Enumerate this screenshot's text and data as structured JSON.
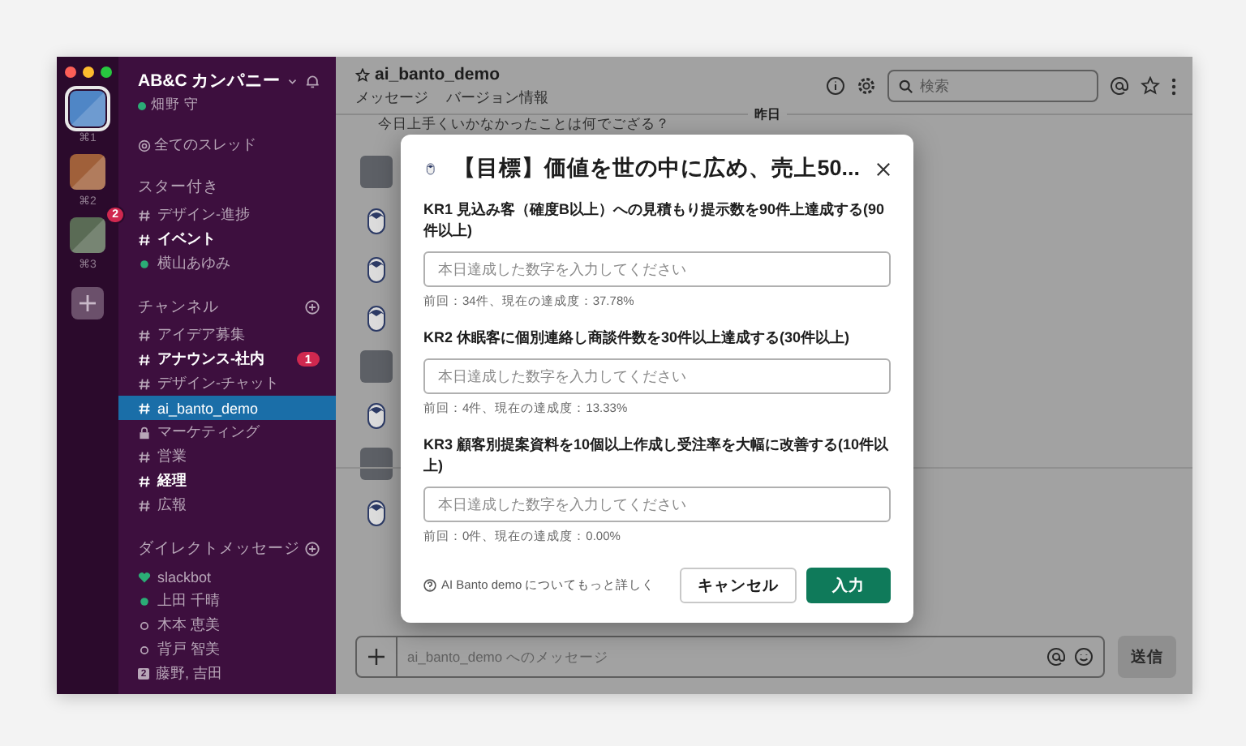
{
  "workspaces": [
    {
      "shortcut": "⌘1",
      "color": "#4f86c6",
      "selected": true
    },
    {
      "shortcut": "⌘2",
      "color": "#a0603a",
      "selected": false
    },
    {
      "shortcut": "⌘3",
      "color": "#5a6b55",
      "badge": "2",
      "selected": false
    }
  ],
  "sidebar": {
    "team_name": "AB&C カンパニー",
    "user_name": "畑野 守",
    "all_threads": "全てのスレッド",
    "sections": [
      {
        "title": "スター付き",
        "has_add_button": false,
        "items": [
          {
            "kind": "channel",
            "label": "デザイン-進捗",
            "unread": false,
            "selected": false
          },
          {
            "kind": "channel",
            "label": "イベント",
            "unread": true,
            "selected": false
          },
          {
            "kind": "online",
            "label": "横山あゆみ",
            "unread": false,
            "selected": false
          }
        ]
      },
      {
        "title": "チャンネル",
        "has_add_button": true,
        "items": [
          {
            "kind": "channel",
            "label": "アイデア募集",
            "unread": false,
            "selected": false
          },
          {
            "kind": "channel",
            "label": "アナウンス-社内",
            "unread": true,
            "badge": "1",
            "selected": false
          },
          {
            "kind": "channel",
            "label": "デザイン-チャット",
            "unread": false,
            "selected": false
          },
          {
            "kind": "channel",
            "label": "ai_banto_demo",
            "unread": false,
            "selected": true
          },
          {
            "kind": "private",
            "label": "マーケティング",
            "unread": false,
            "selected": false
          },
          {
            "kind": "channel",
            "label": "営業",
            "unread": false,
            "selected": false
          },
          {
            "kind": "channel",
            "label": "経理",
            "unread": true,
            "selected": false
          },
          {
            "kind": "channel",
            "label": "広報",
            "unread": false,
            "selected": false
          }
        ]
      },
      {
        "title": "ダイレクトメッセージ",
        "has_add_button": true,
        "items": [
          {
            "kind": "bot",
            "label": "slackbot",
            "unread": false,
            "selected": false
          },
          {
            "kind": "online",
            "label": "上田 千晴",
            "unread": false,
            "selected": false
          },
          {
            "kind": "offline",
            "label": "木本 恵美",
            "unread": false,
            "selected": false
          },
          {
            "kind": "offline",
            "label": "背戸 智美",
            "unread": false,
            "selected": false
          },
          {
            "kind": "group",
            "label": "藤野, 吉田",
            "member_count": "2",
            "unread": false,
            "selected": false
          }
        ]
      }
    ]
  },
  "channel_header": {
    "title": "ai_banto_demo",
    "tabs": [
      "メッセージ",
      "バージョン情報"
    ],
    "search": {
      "placeholder": "検索"
    }
  },
  "feed": {
    "partial_message": "今日上手くいかなかったことは何でござる？",
    "date_divider": "昨日"
  },
  "composer": {
    "placeholder": "ai_banto_demo へのメッセージ",
    "send_button": "送信"
  },
  "dialog": {
    "title": "【目標】価値を世の中に広め、売上50...",
    "key_results": [
      {
        "label": "KR1 見込み客（確度B以上）への見積もり提示数を90件上達成する(90件以上)",
        "placeholder": "本日達成した数字を入力してください",
        "note": "前回：34件、現在の達成度：37.78%"
      },
      {
        "label": "KR2 休眠客に個別連絡し商談件数を30件以上達成する(30件以上)",
        "placeholder": "本日達成した数字を入力してください",
        "note": "前回：4件、現在の達成度：13.33%"
      },
      {
        "label": "KR3 顧客別提案資料を10個以上作成し受注率を大幅に改善する(10件以上)",
        "placeholder": "本日達成した数字を入力してください",
        "note": "前回：0件、現在の達成度：0.00%"
      }
    ],
    "help_link": "AI Banto demo についてもっと詳しく",
    "cancel_button": "キャンセル",
    "submit_button": "入力"
  }
}
